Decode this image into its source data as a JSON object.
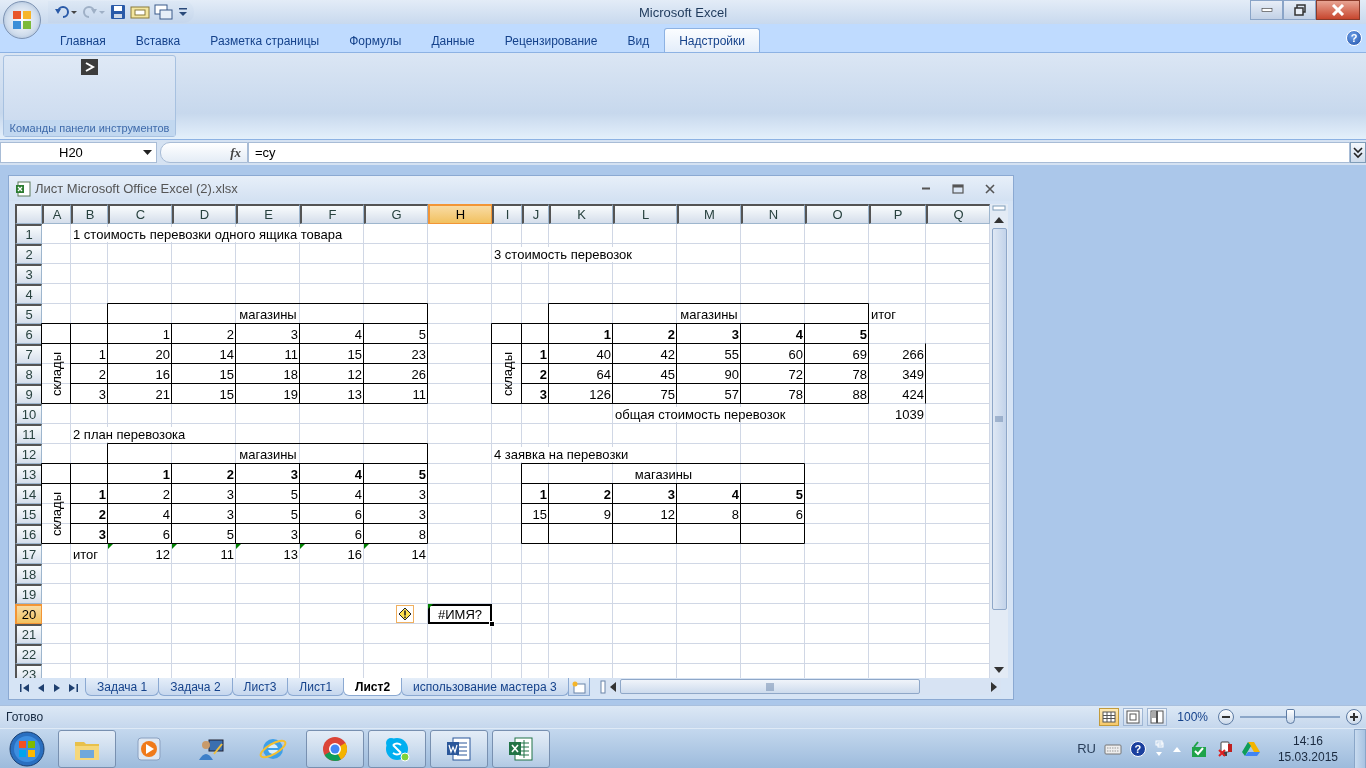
{
  "window": {
    "title": "Microsoft Excel"
  },
  "quick_access": [
    {
      "kind": "undo",
      "disabled": false
    },
    {
      "kind": "redo",
      "disabled": true
    },
    {
      "kind": "save",
      "disabled": false
    },
    {
      "kind": "camera"
    },
    {
      "kind": "windows"
    }
  ],
  "ribbon": {
    "tabs": [
      {
        "label": "Главная",
        "selected": false
      },
      {
        "label": "Вставка",
        "selected": false
      },
      {
        "label": "Разметка страницы",
        "selected": false
      },
      {
        "label": "Формулы",
        "selected": false
      },
      {
        "label": "Данные",
        "selected": false
      },
      {
        "label": "Рецензирование",
        "selected": false
      },
      {
        "label": "Вид",
        "selected": false
      },
      {
        "label": "Надстройки",
        "selected": true
      }
    ],
    "help": "?",
    "groups": [
      {
        "label": "Команды панели инструментов"
      }
    ]
  },
  "formula_bar": {
    "name_box": "H20",
    "function_button": "fx",
    "formula": "=су"
  },
  "workbook": {
    "title": "Лист Microsoft Office Excel (2).xlsx",
    "columns": [
      {
        "label": "A",
        "selected": false
      },
      {
        "label": "B",
        "selected": false
      },
      {
        "label": "C",
        "selected": false
      },
      {
        "label": "D",
        "selected": false
      },
      {
        "label": "E",
        "selected": false
      },
      {
        "label": "F",
        "selected": false
      },
      {
        "label": "G",
        "selected": false
      },
      {
        "label": "H",
        "selected": true
      },
      {
        "label": "I",
        "selected": false
      },
      {
        "label": "J",
        "selected": false
      },
      {
        "label": "K",
        "selected": false
      },
      {
        "label": "L",
        "selected": false
      },
      {
        "label": "M",
        "selected": false
      },
      {
        "label": "N",
        "selected": false
      },
      {
        "label": "O",
        "selected": false
      },
      {
        "label": "P",
        "selected": false
      },
      {
        "label": "Q",
        "selected": false
      }
    ],
    "rows": [
      {
        "label": "1",
        "selected": false,
        "cells": [
          null,
          {
            "text": "1 стоимость перевозки одного ящика товара"
          },
          null,
          null,
          null,
          null,
          null,
          null,
          null,
          null,
          null,
          null,
          null,
          null,
          null,
          null,
          null
        ]
      },
      {
        "label": "2",
        "selected": false,
        "cells": [
          null,
          null,
          null,
          null,
          null,
          null,
          null,
          null,
          {
            "text": "3 стоимость перевозок"
          },
          null,
          null,
          null,
          null,
          null,
          null,
          null,
          null
        ]
      },
      {
        "label": "3",
        "selected": false
      },
      {
        "label": "4",
        "selected": false
      },
      {
        "label": "5",
        "selected": false,
        "cells": [
          null,
          null,
          {
            "text": "магазины",
            "center": true,
            "boxed": true
          },
          {
            "merged_left": true
          },
          {
            "merged_left": true
          },
          {
            "merged_left": true
          },
          {
            "merged_left": true
          },
          null,
          null,
          null,
          {
            "text": "магазины",
            "center": true,
            "boxed": true
          },
          {
            "merged_left": true
          },
          {
            "merged_left": true
          },
          {
            "merged_left": true
          },
          {
            "merged_left": true
          },
          {
            "text": "итог"
          },
          null
        ]
      },
      {
        "label": "6",
        "selected": false,
        "cells": [
          {
            "boxed": true
          },
          {
            "boxed": true
          },
          {
            "text": "1",
            "right": true,
            "boxed": true
          },
          {
            "text": "2",
            "right": true,
            "boxed": true
          },
          {
            "text": "3",
            "right": true,
            "boxed": true
          },
          {
            "text": "4",
            "right": true,
            "boxed": true
          },
          {
            "text": "5",
            "right": true,
            "boxed": true
          },
          null,
          {
            "boxed": true
          },
          {
            "boxed": true
          },
          {
            "text": "1",
            "right": true,
            "boxed": true,
            "bold": true
          },
          {
            "text": "2",
            "right": true,
            "boxed": true,
            "bold": true
          },
          {
            "text": "3",
            "right": true,
            "boxed": true,
            "bold": true
          },
          {
            "text": "4",
            "right": true,
            "boxed": true,
            "bold": true
          },
          {
            "text": "5",
            "right": true,
            "boxed": true,
            "bold": true
          },
          null,
          null
        ]
      },
      {
        "label": "7",
        "selected": false,
        "cells": [
          {
            "text": "склады",
            "vertical": true,
            "boxed": true
          },
          {
            "text": "1",
            "right": true,
            "boxed": true
          },
          {
            "text": "20",
            "right": true,
            "boxed": true
          },
          {
            "text": "14",
            "right": true,
            "boxed": true
          },
          {
            "text": "11",
            "right": true,
            "boxed": true
          },
          {
            "text": "15",
            "right": true,
            "boxed": true
          },
          {
            "text": "23",
            "right": true,
            "boxed": true
          },
          null,
          {
            "text": "склады",
            "vertical": true,
            "boxed": true
          },
          {
            "text": "1",
            "right": true,
            "boxed": true,
            "bold": true
          },
          {
            "text": "40",
            "right": true,
            "boxed": true
          },
          {
            "text": "42",
            "right": true,
            "boxed": true
          },
          {
            "text": "55",
            "right": true,
            "boxed": true
          },
          {
            "text": "60",
            "right": true,
            "boxed": true
          },
          {
            "text": "69",
            "right": true,
            "boxed": true
          },
          {
            "text": "266",
            "right": true,
            "right_border": true
          },
          null
        ]
      },
      {
        "label": "8",
        "selected": false,
        "cells": [
          {
            "merged_up": true
          },
          {
            "text": "2",
            "right": true,
            "boxed": true
          },
          {
            "text": "16",
            "right": true,
            "boxed": true
          },
          {
            "text": "15",
            "right": true,
            "boxed": true
          },
          {
            "text": "18",
            "right": true,
            "boxed": true
          },
          {
            "text": "12",
            "right": true,
            "boxed": true
          },
          {
            "text": "26",
            "right": true,
            "boxed": true
          },
          null,
          {
            "merged_up": true
          },
          {
            "text": "2",
            "right": true,
            "boxed": true,
            "bold": true
          },
          {
            "text": "64",
            "right": true,
            "boxed": true
          },
          {
            "text": "45",
            "right": true,
            "boxed": true
          },
          {
            "text": "90",
            "right": true,
            "boxed": true
          },
          {
            "text": "72",
            "right": true,
            "boxed": true
          },
          {
            "text": "78",
            "right": true,
            "boxed": true
          },
          {
            "text": "349",
            "right": true,
            "right_border": true
          },
          null
        ]
      },
      {
        "label": "9",
        "selected": false,
        "cells": [
          {
            "merged_up": true
          },
          {
            "text": "3",
            "right": true,
            "boxed": true
          },
          {
            "text": "21",
            "right": true,
            "boxed": true
          },
          {
            "text": "15",
            "right": true,
            "boxed": true
          },
          {
            "text": "19",
            "right": true,
            "boxed": true
          },
          {
            "text": "13",
            "right": true,
            "boxed": true
          },
          {
            "text": "11",
            "right": true,
            "boxed": true
          },
          null,
          {
            "merged_up": true
          },
          {
            "text": "3",
            "right": true,
            "boxed": true,
            "bold": true
          },
          {
            "text": "126",
            "right": true,
            "boxed": true
          },
          {
            "text": "75",
            "right": true,
            "boxed": true
          },
          {
            "text": "57",
            "right": true,
            "boxed": true
          },
          {
            "text": "78",
            "right": true,
            "boxed": true
          },
          {
            "text": "88",
            "right": true,
            "boxed": true
          },
          {
            "text": "424",
            "right": true,
            "right_border": true
          },
          null
        ]
      },
      {
        "label": "10",
        "selected": false,
        "cells": [
          null,
          null,
          null,
          null,
          null,
          null,
          null,
          null,
          null,
          null,
          null,
          {
            "text": "общая стоимость перевозок"
          },
          null,
          null,
          null,
          {
            "text": "1039",
            "right": true
          },
          null
        ]
      },
      {
        "label": "11",
        "selected": false,
        "cells": [
          null,
          {
            "text": "2 план перевозока"
          },
          null,
          null,
          null,
          null,
          null,
          null,
          null,
          null,
          null,
          null,
          null,
          null,
          null,
          null,
          null
        ]
      },
      {
        "label": "12",
        "selected": false,
        "cells": [
          null,
          null,
          {
            "text": "магазины",
            "center": true,
            "boxed": true
          },
          {
            "merged_left": true
          },
          {
            "merged_left": true
          },
          {
            "merged_left": true
          },
          {
            "merged_left": true
          },
          null,
          {
            "text": "4 заявка на перевозки"
          },
          null,
          null,
          null,
          null,
          null,
          null,
          null,
          null
        ]
      },
      {
        "label": "13",
        "selected": false,
        "cells": [
          {
            "boxed": true
          },
          {
            "boxed": true
          },
          {
            "text": "1",
            "right": true,
            "boxed": true,
            "bold": true
          },
          {
            "text": "2",
            "right": true,
            "boxed": true,
            "bold": true
          },
          {
            "text": "3",
            "right": true,
            "boxed": true,
            "bold": true
          },
          {
            "text": "4",
            "right": true,
            "boxed": true,
            "bold": true
          },
          {
            "text": "5",
            "right": true,
            "boxed": true,
            "bold": true
          },
          null,
          null,
          {
            "text": "магазины",
            "center": true,
            "boxed": true
          },
          {
            "merged_left": true
          },
          {
            "merged_left": true
          },
          {
            "merged_left": true
          },
          {
            "merged_left": true
          },
          null,
          null,
          null
        ]
      },
      {
        "label": "14",
        "selected": false,
        "cells": [
          {
            "text": "склады",
            "vertical": true,
            "boxed": true
          },
          {
            "text": "1",
            "right": true,
            "boxed": true,
            "bold": true
          },
          {
            "text": "2",
            "right": true,
            "boxed": true
          },
          {
            "text": "3",
            "right": true,
            "boxed": true
          },
          {
            "text": "5",
            "right": true,
            "boxed": true
          },
          {
            "text": "4",
            "right": true,
            "boxed": true
          },
          {
            "text": "3",
            "right": true,
            "boxed": true
          },
          null,
          null,
          {
            "text": "1",
            "right": true,
            "boxed": true,
            "bold": true
          },
          {
            "text": "2",
            "right": true,
            "boxed": true,
            "bold": true
          },
          {
            "text": "3",
            "right": true,
            "boxed": true,
            "bold": true
          },
          {
            "text": "4",
            "right": true,
            "boxed": true,
            "bold": true
          },
          {
            "text": "5",
            "right": true,
            "boxed": true,
            "bold": true
          },
          null,
          null,
          null
        ]
      },
      {
        "label": "15",
        "selected": false,
        "cells": [
          {
            "merged_up": true
          },
          {
            "text": "2",
            "right": true,
            "boxed": true,
            "bold": true
          },
          {
            "text": "4",
            "right": true,
            "boxed": true
          },
          {
            "text": "3",
            "right": true,
            "boxed": true
          },
          {
            "text": "5",
            "right": true,
            "boxed": true
          },
          {
            "text": "6",
            "right": true,
            "boxed": true
          },
          {
            "text": "3",
            "right": true,
            "boxed": true
          },
          null,
          null,
          {
            "text": "15",
            "right": true,
            "boxed": true
          },
          {
            "text": "9",
            "right": true,
            "boxed": true
          },
          {
            "text": "12",
            "right": true,
            "boxed": true
          },
          {
            "text": "8",
            "right": true,
            "boxed": true
          },
          {
            "text": "6",
            "right": true,
            "boxed": true
          },
          null,
          null,
          null
        ]
      },
      {
        "label": "16",
        "selected": false,
        "cells": [
          {
            "merged_up": true
          },
          {
            "text": "3",
            "right": true,
            "boxed": true,
            "bold": true
          },
          {
            "text": "6",
            "right": true,
            "boxed": true
          },
          {
            "text": "5",
            "right": true,
            "boxed": true
          },
          {
            "text": "3",
            "right": true,
            "boxed": true
          },
          {
            "text": "6",
            "right": true,
            "boxed": true
          },
          {
            "text": "8",
            "right": true,
            "boxed": true
          },
          null,
          null,
          {
            "boxed": true
          },
          {
            "boxed": true
          },
          {
            "boxed": true
          },
          {
            "boxed": true
          },
          {
            "boxed": true
          },
          null,
          null,
          null
        ]
      },
      {
        "label": "17",
        "selected": false,
        "cells": [
          null,
          {
            "text": "итог"
          },
          {
            "text": "12",
            "right": true,
            "flag": true
          },
          {
            "text": "11",
            "right": true,
            "flag": true
          },
          {
            "text": "13",
            "right": true,
            "flag": true
          },
          {
            "text": "16",
            "right": true,
            "flag": true
          },
          {
            "text": "14",
            "right": true,
            "flag": true
          },
          null,
          null,
          null,
          null,
          null,
          null,
          null,
          null,
          null,
          null
        ]
      },
      {
        "label": "18",
        "selected": false
      },
      {
        "label": "19",
        "selected": false
      },
      {
        "label": "20",
        "selected": true,
        "cells": [
          null,
          null,
          null,
          null,
          null,
          null,
          null,
          {
            "text": "#ИМЯ?",
            "center": true,
            "flag": true,
            "active": true,
            "warning": true
          },
          null,
          null,
          null,
          null,
          null,
          null,
          null,
          null,
          null
        ]
      },
      {
        "label": "21",
        "selected": false
      },
      {
        "label": "22",
        "selected": false
      },
      {
        "label": "23",
        "selected": false
      }
    ],
    "sheet_tabs": [
      {
        "label": "Задача 1",
        "selected": false
      },
      {
        "label": "Задача 2",
        "selected": false
      },
      {
        "label": "Лист3",
        "selected": false
      },
      {
        "label": "Лист1",
        "selected": false
      },
      {
        "label": "Лист2",
        "selected": true
      },
      {
        "label": "использование мастера 3",
        "selected": false
      }
    ]
  },
  "status_bar": {
    "status": "Готово",
    "views": [
      {
        "kind": "normal",
        "selected": true
      },
      {
        "kind": "page-layout",
        "selected": false
      },
      {
        "kind": "page-break",
        "selected": false
      }
    ],
    "zoom": "100%",
    "zoom_slider": {
      "level": 0.5
    }
  },
  "taskbar": {
    "apps": [
      {
        "kind": "explorer",
        "running": true
      },
      {
        "kind": "media",
        "running": false
      },
      {
        "kind": "user",
        "running": false
      },
      {
        "kind": "ie",
        "running": false
      },
      {
        "kind": "chrome",
        "running": true
      },
      {
        "kind": "skype",
        "running": true
      },
      {
        "kind": "word",
        "running": true
      },
      {
        "kind": "excel",
        "running": true
      }
    ],
    "tray": {
      "language": "RU",
      "help": "?",
      "time": "14:16",
      "date": "15.03.2015"
    }
  }
}
